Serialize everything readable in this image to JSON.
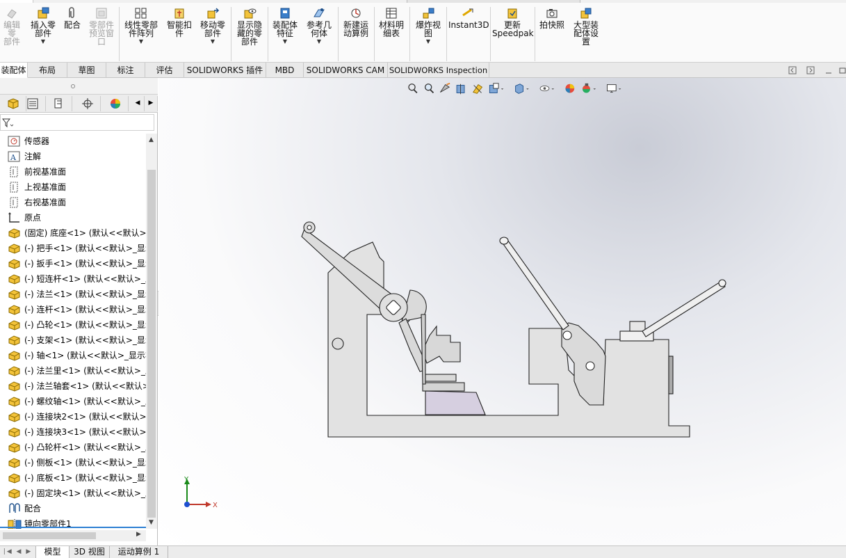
{
  "toolbar": {
    "edit_part": [
      "编辑零",
      "部件"
    ],
    "insert_part": [
      "插入零",
      "部件"
    ],
    "mate": "配合",
    "preview_window": [
      "零部件",
      "预览窗",
      "口"
    ],
    "linear_pattern": [
      "线性零部",
      "件阵列"
    ],
    "smart_fastener": [
      "智能扣",
      "件"
    ],
    "move_part": [
      "移动零",
      "部件"
    ],
    "show_hidden": [
      "显示隐",
      "藏的零",
      "部件"
    ],
    "assembly_features": [
      "装配体",
      "特征"
    ],
    "ref_geometry": [
      "参考几",
      "何体"
    ],
    "new_motion": [
      "新建运",
      "动算例"
    ],
    "bom": [
      "材料明",
      "细表"
    ],
    "explode_view": [
      "爆炸视",
      "图"
    ],
    "instant3d": "Instant3D",
    "speedpak": [
      "更新",
      "Speedpak"
    ],
    "snapshot": "拍快照",
    "large_assembly": [
      "大型装",
      "配体设",
      "置"
    ]
  },
  "tabs": [
    "装配体",
    "布局",
    "草图",
    "标注",
    "评估",
    "SOLIDWORKS 插件",
    "MBD",
    "SOLIDWORKS CAM",
    "SOLIDWORKS Inspection"
  ],
  "tree": [
    {
      "icon": "sensor",
      "label": "传感器"
    },
    {
      "icon": "annotation",
      "label": "注解"
    },
    {
      "icon": "plane",
      "label": "前视基准面"
    },
    {
      "icon": "plane",
      "label": "上视基准面"
    },
    {
      "icon": "plane",
      "label": "右视基准面"
    },
    {
      "icon": "origin",
      "label": "原点"
    },
    {
      "icon": "part",
      "label": "(固定) 底座<1> (默认<<默认>_"
    },
    {
      "icon": "part",
      "label": "(-) 把手<1> (默认<<默认>_显示"
    },
    {
      "icon": "part",
      "label": "(-) 扳手<1> (默认<<默认>_显示"
    },
    {
      "icon": "part",
      "label": "(-) 短连杆<1> (默认<<默认>_显"
    },
    {
      "icon": "part",
      "label": "(-) 法兰<1> (默认<<默认>_显示"
    },
    {
      "icon": "part",
      "label": "(-) 连杆<1> (默认<<默认>_显示"
    },
    {
      "icon": "part",
      "label": "(-) 凸轮<1> (默认<<默认>_显示"
    },
    {
      "icon": "part",
      "label": "(-) 支架<1> (默认<<默认>_显示"
    },
    {
      "icon": "part",
      "label": "(-) 轴<1> (默认<<默认>_显示状"
    },
    {
      "icon": "part",
      "label": "(-) 法兰里<1> (默认<<默认>_显"
    },
    {
      "icon": "part",
      "label": "(-) 法兰轴套<1> (默认<<默认>_"
    },
    {
      "icon": "part",
      "label": "(-) 螺纹轴<1> (默认<<默认>_显"
    },
    {
      "icon": "part",
      "label": "(-) 连接块2<1> (默认<<默认>_"
    },
    {
      "icon": "part",
      "label": "(-) 连接块3<1> (默认<<默认>_"
    },
    {
      "icon": "part",
      "label": "(-) 凸轮杆<1> (默认<<默认>_显"
    },
    {
      "icon": "part",
      "label": "(-) 侧板<1> (默认<<默认>_显示"
    },
    {
      "icon": "part",
      "label": "(-) 底板<1> (默认<<默认>_显示"
    },
    {
      "icon": "part",
      "label": "(-) 固定块<1> (默认<<默认>_显"
    },
    {
      "icon": "mates",
      "label": "配合"
    },
    {
      "icon": "mirror",
      "label": "镜向零部件1"
    }
  ],
  "triad": {
    "x": "X",
    "y": "Y"
  },
  "bottom_tabs": [
    "模型",
    "3D 视图",
    "运动算例 1"
  ]
}
